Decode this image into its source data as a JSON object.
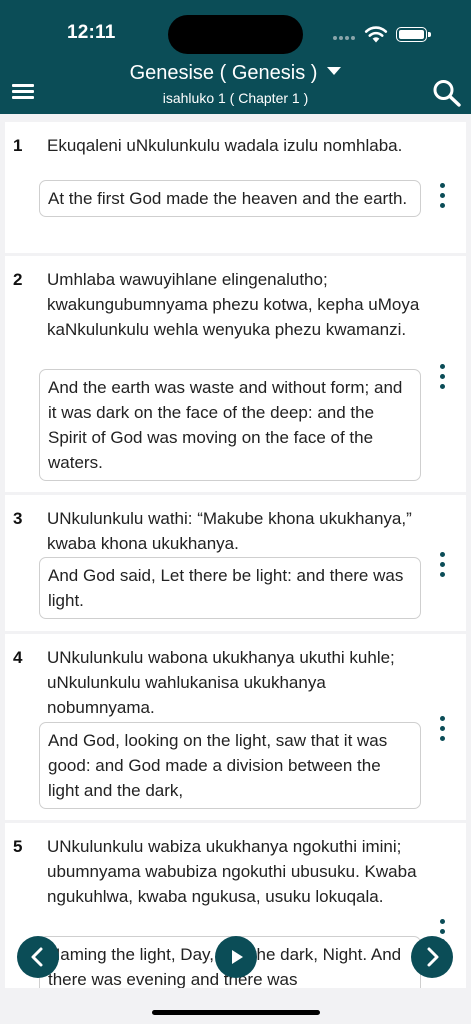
{
  "status_bar": {
    "time": "12:11"
  },
  "header": {
    "book_title": "Genesise ( Genesis )",
    "chapter_title": "isahluko 1 ( Chapter 1 )"
  },
  "verses": [
    {
      "number": "1",
      "text": "Ekuqaleni uNkulunkulu wadala izulu nomhlaba.",
      "translation": "At the first God made the heaven and the earth."
    },
    {
      "number": "2",
      "text": "Umhlaba wawuyihlane elingenalutho; kwakungubumnyama phezu kotwa, kepha uMoya kaNkulunkulu wehla wenyuka phezu kwamanzi.",
      "translation": "And the earth was waste and without form; and it was dark on the face of the deep: and the Spirit of God was moving on the face of the waters."
    },
    {
      "number": "3",
      "text": "UNkulunkulu wathi: “Makube khona ukukhanya,” kwaba khona ukukhanya.",
      "translation": "And God said, Let there be light: and there was light."
    },
    {
      "number": "4",
      "text": "UNkulunkulu wabona ukukhanya ukuthi kuhle; uNkulunkulu wahlukanisa ukukhanya nobumnyama.",
      "translation": "And God, looking on the light, saw that it was good: and God made a division between the light and the dark,"
    },
    {
      "number": "5",
      "text": "UNkulunkulu wabiza ukukhanya ngokuthi imini; ubumnyama wabubiza ngokuthi ubusuku. Kwaba ngukuhlwa, kwaba ngukusa, usuku lokuqala.",
      "translation": "Naming the light, Day, and the dark, Night. And there was evening and there was"
    }
  ],
  "icons": {
    "menu": "hamburger-icon",
    "search": "search-icon",
    "more": "more-vertical-icon",
    "prev": "chevron-left-icon",
    "play": "play-icon",
    "next": "chevron-right-icon"
  },
  "colors": {
    "primary": "#0b4d57",
    "background": "#f2f2f4"
  }
}
